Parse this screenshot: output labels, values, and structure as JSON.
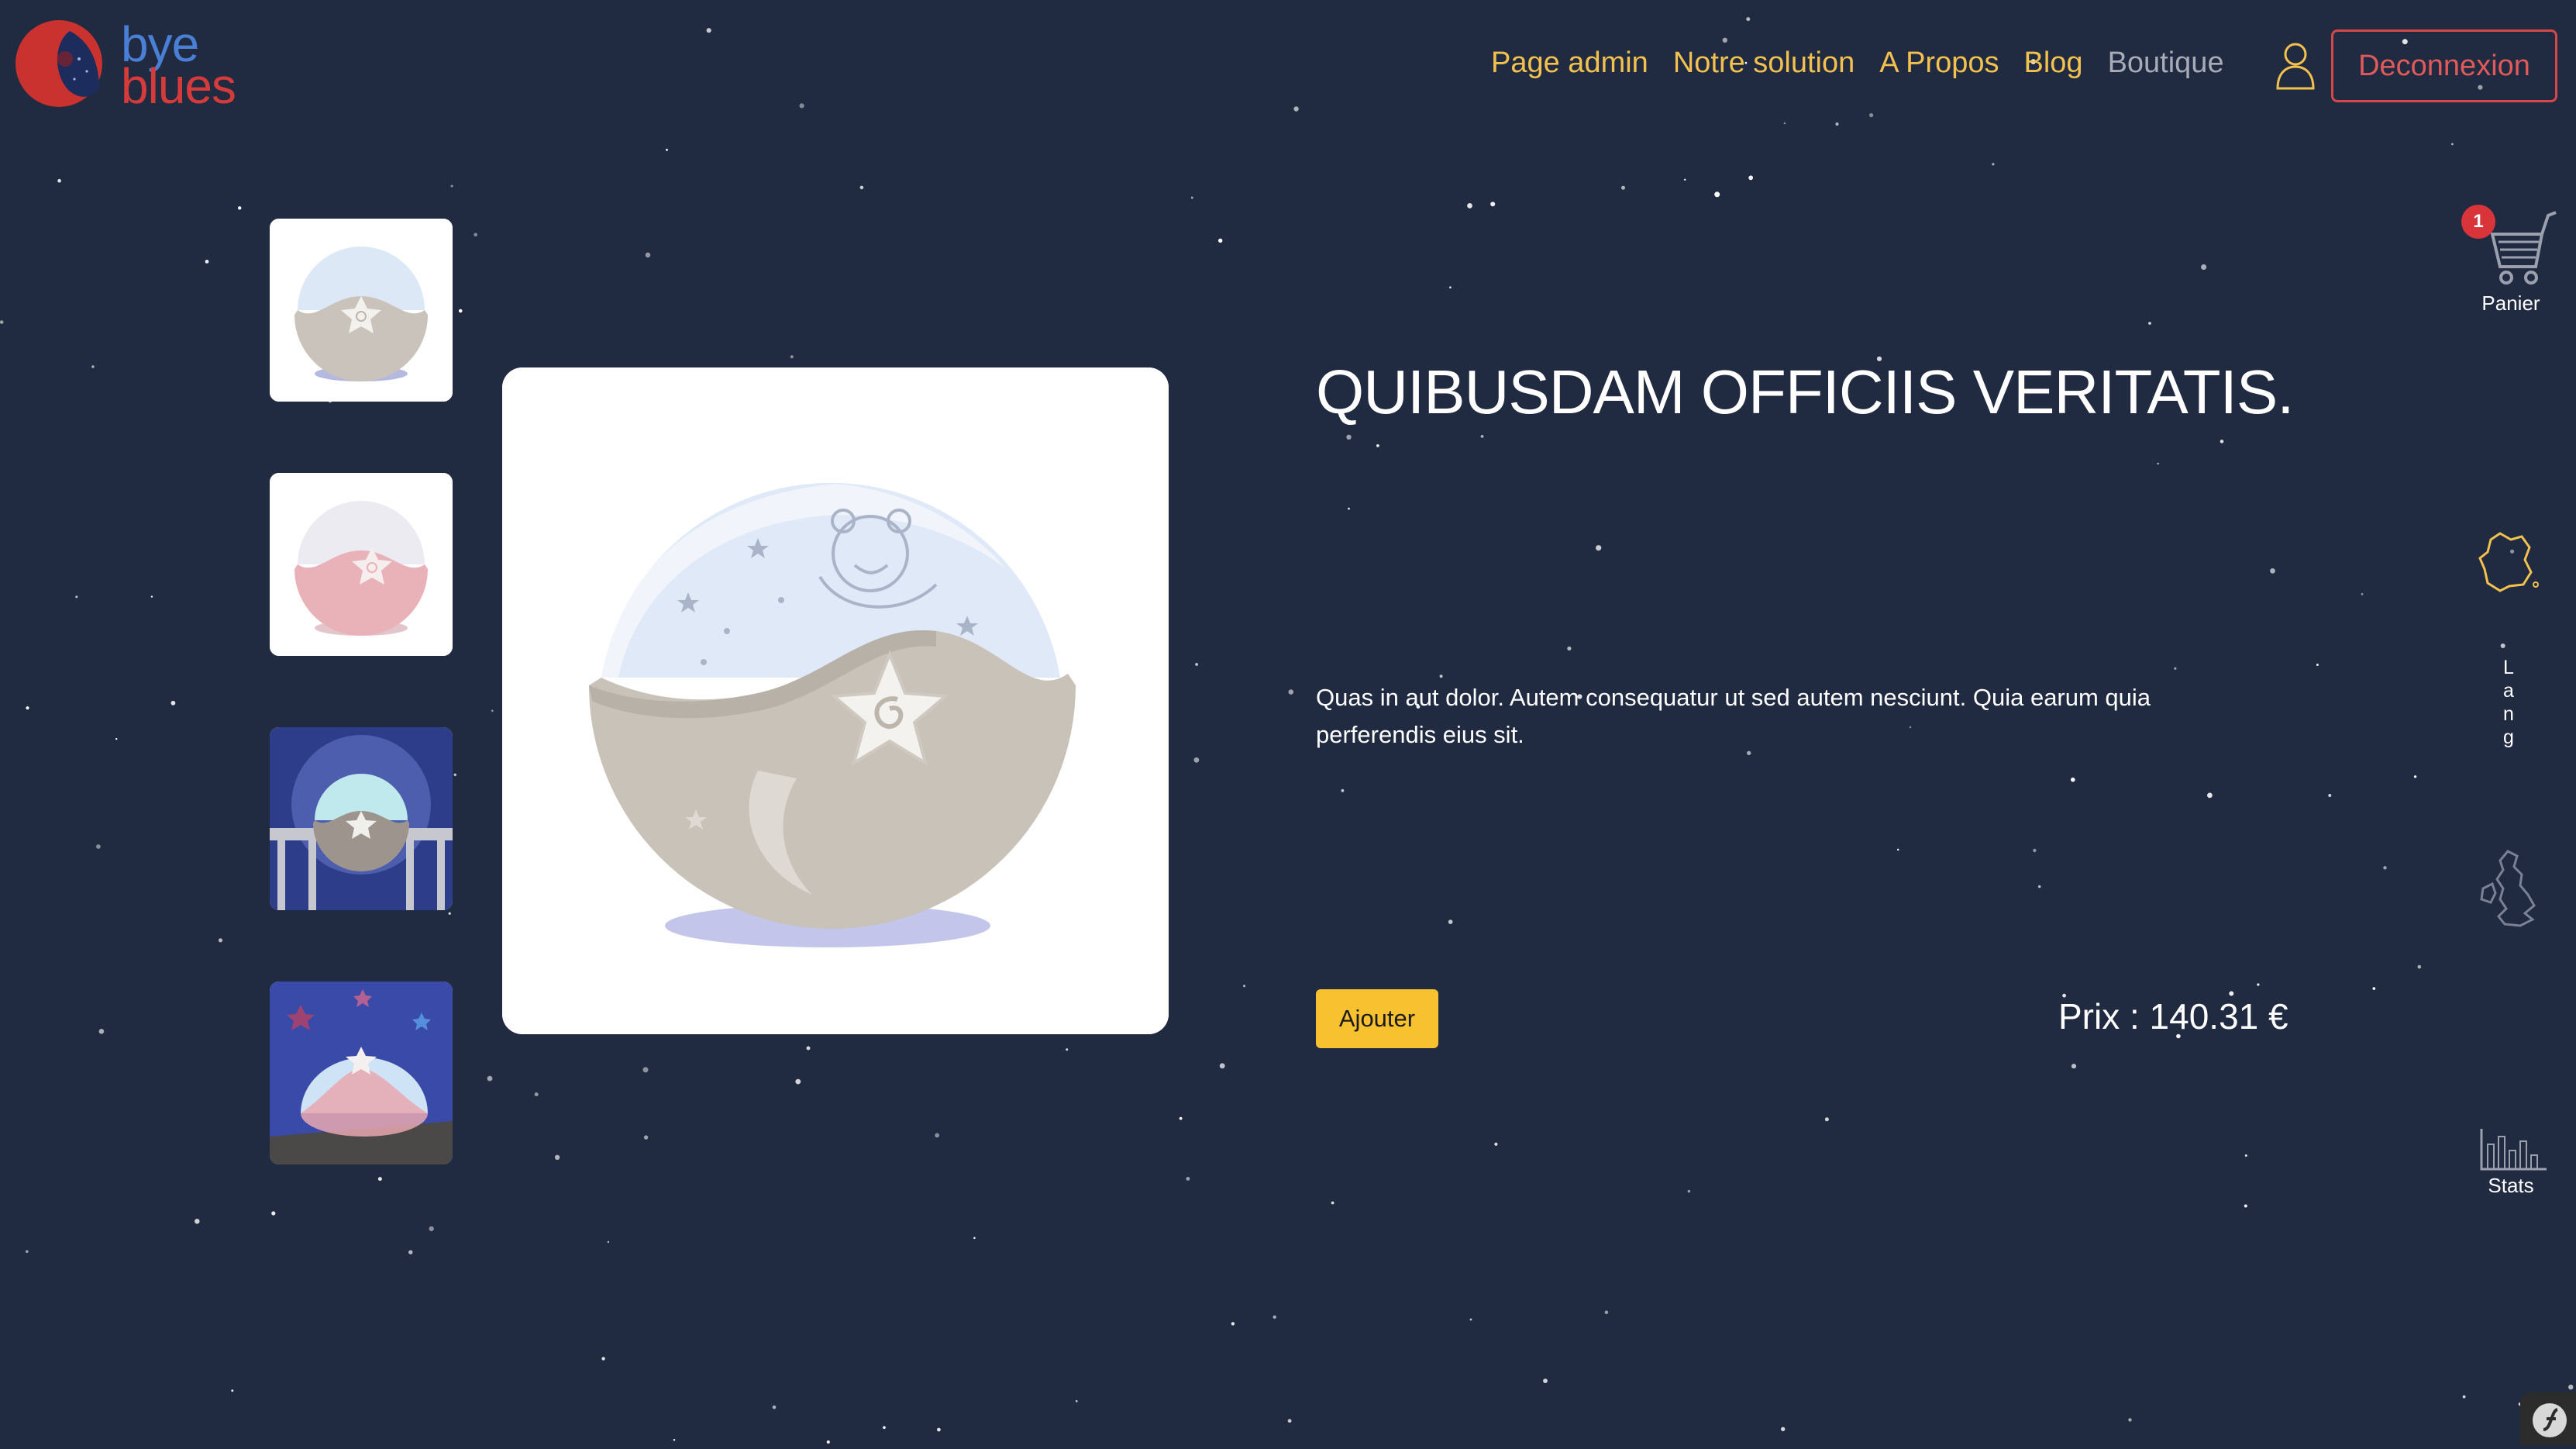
{
  "brand": {
    "logo_line1": "bye",
    "logo_line2": "blues",
    "colors": {
      "line1": "#4a7fd6",
      "line2": "#d63b3b",
      "sphere": "#c9322e"
    }
  },
  "nav": {
    "items": [
      {
        "label": "Page admin",
        "style": "accent"
      },
      {
        "label": "Notre solution",
        "style": "accent"
      },
      {
        "label": "A Propos",
        "style": "accent"
      },
      {
        "label": "Blog",
        "style": "accent"
      },
      {
        "label": "Boutique",
        "style": "muted"
      }
    ],
    "user_icon": "user-icon",
    "logout_label": "Deconnexion"
  },
  "product": {
    "title": "QUIBUSDAM OFFICIIS VERITATIS.",
    "description": "Quas in aut dolor. Autem consequatur ut sed autem nesciunt. Quia earum quia perferendis eius sit.",
    "add_button_label": "Ajouter",
    "price": "Prix : 140.31 €",
    "thumbnails": [
      {
        "variant": "white-nightlight"
      },
      {
        "variant": "pink-nightlight"
      },
      {
        "variant": "nightlight-in-crib"
      },
      {
        "variant": "nightlight-projection"
      }
    ]
  },
  "sidebar": {
    "cart": {
      "badge_count": "1",
      "label": "Panier",
      "icon": "cart-icon"
    },
    "flag_fr": {
      "icon": "france-map-icon"
    },
    "lang_letters": [
      "L",
      "a",
      "n",
      "g"
    ],
    "flag_en": {
      "icon": "uk-map-icon"
    },
    "stats": {
      "label": "Stats",
      "icon": "bar-chart-icon"
    }
  },
  "colors": {
    "background": "#202a40",
    "accent": "#f2c14e",
    "muted": "#a7acb6",
    "danger": "#d54848",
    "button": "#f8c12f"
  }
}
